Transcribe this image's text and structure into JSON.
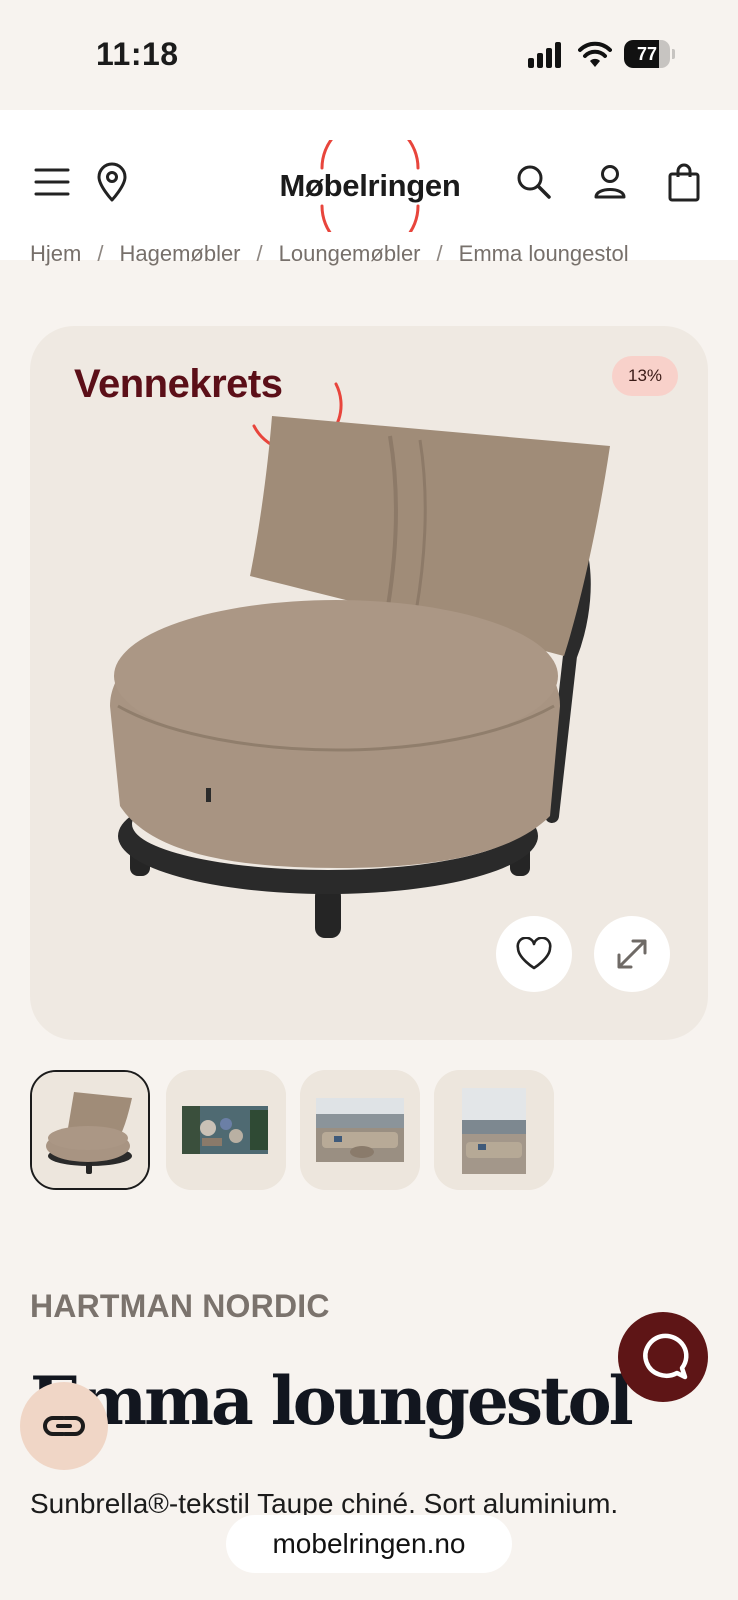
{
  "status_bar": {
    "time": "11:18",
    "battery_level": "77",
    "battery_fraction": 0.77,
    "icons": [
      "signal-icon",
      "wifi-icon",
      "battery-icon"
    ]
  },
  "header": {
    "logo_text": "Møbelringen",
    "icons": [
      "menu-icon",
      "location-pin-icon",
      "search-icon",
      "user-icon",
      "shopping-bag-icon"
    ],
    "accent_color": "#e8453c"
  },
  "breadcrumb": {
    "items": [
      "Hjem",
      "Hagemøbler",
      "Loungemøbler",
      "Emma loungestol"
    ],
    "separator": "/"
  },
  "gallery": {
    "campaign_label": "Vennekrets",
    "discount_badge": "13%",
    "buttons": [
      "heart-icon",
      "expand-icon"
    ]
  },
  "thumbnails": {
    "count": 4,
    "selected_index": 0
  },
  "product": {
    "brand": "HARTMAN NORDIC",
    "title": "Emma loungestol",
    "subtitle": "Sunbrella®-tekstil Taupe chiné. Sort aluminium."
  },
  "floating": {
    "chat_color": "#5e1516",
    "url": "mobelringen.no"
  }
}
